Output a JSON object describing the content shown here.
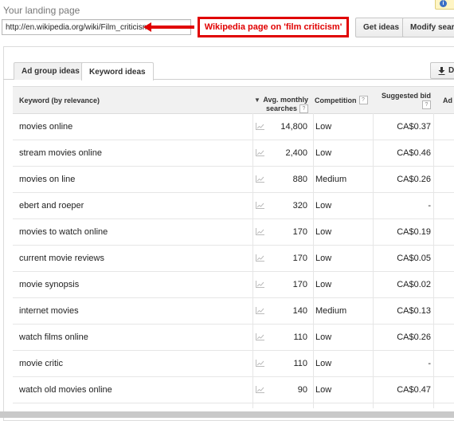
{
  "landing_label": "Your landing page",
  "url_value": "http://en.wikipedia.org/wiki/Film_criticism",
  "callout_text": "Wikipedia page on 'film criticism'",
  "buttons": {
    "get_ideas": "Get ideas",
    "modify_search": "Modify search"
  },
  "tabs": {
    "ad_group": "Ad group ideas",
    "keyword": "Keyword ideas"
  },
  "download_label": "D",
  "columns": {
    "keyword": "Keyword (by relevance)",
    "avg_line1": "Avg. monthly",
    "avg_line2": "searches",
    "competition": "Competition",
    "bid": "Suggested bid",
    "ad": "Ad"
  },
  "help_glyph": "?",
  "rows": [
    {
      "keyword": "movies online",
      "volume": "14,800",
      "competition": "Low",
      "bid": "CA$0.37"
    },
    {
      "keyword": "stream movies online",
      "volume": "2,400",
      "competition": "Low",
      "bid": "CA$0.46"
    },
    {
      "keyword": "movies on line",
      "volume": "880",
      "competition": "Medium",
      "bid": "CA$0.26"
    },
    {
      "keyword": "ebert and roeper",
      "volume": "320",
      "competition": "Low",
      "bid": "-"
    },
    {
      "keyword": "movies to watch online",
      "volume": "170",
      "competition": "Low",
      "bid": "CA$0.19"
    },
    {
      "keyword": "current movie reviews",
      "volume": "170",
      "competition": "Low",
      "bid": "CA$0.05"
    },
    {
      "keyword": "movie synopsis",
      "volume": "170",
      "competition": "Low",
      "bid": "CA$0.02"
    },
    {
      "keyword": "internet movies",
      "volume": "140",
      "competition": "Medium",
      "bid": "CA$0.13"
    },
    {
      "keyword": "watch films online",
      "volume": "110",
      "competition": "Low",
      "bid": "CA$0.26"
    },
    {
      "keyword": "movie critic",
      "volume": "110",
      "competition": "Low",
      "bid": "-"
    },
    {
      "keyword": "watch old movies online",
      "volume": "90",
      "competition": "Low",
      "bid": "CA$0.47"
    }
  ],
  "colors": {
    "callout": "#e00000",
    "header_bg": "#f1f1f1"
  },
  "icons": {
    "trend": "trend-chart-icon",
    "sort": "sort-down-icon",
    "download": "download-icon",
    "info": "info-icon"
  }
}
